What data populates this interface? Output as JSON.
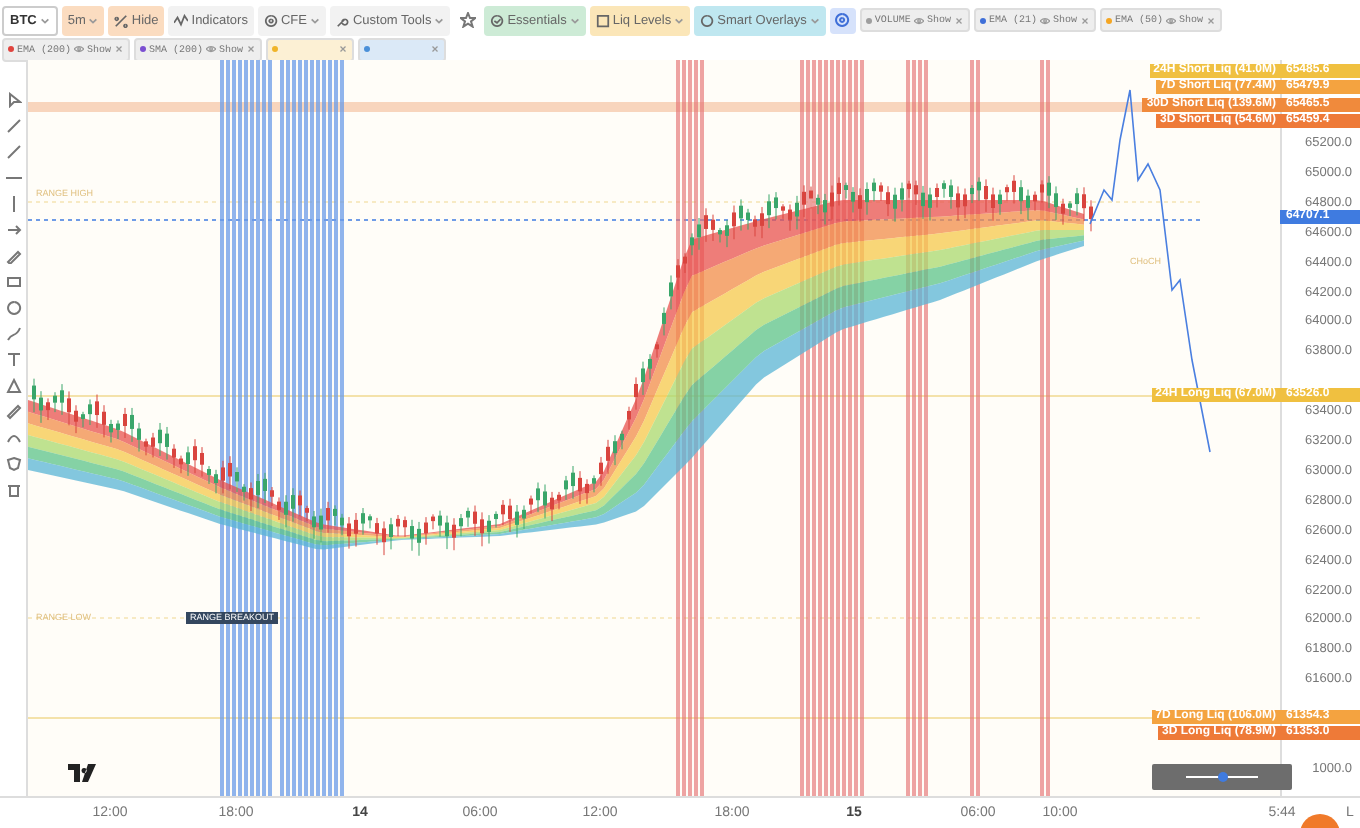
{
  "toolbar": {
    "buttons": [
      {
        "label": "BTC",
        "color": "#ffffff",
        "caret": true,
        "icon": false
      },
      {
        "label": "5m",
        "color": "#fbdcc0",
        "caret": true,
        "icon": false
      },
      {
        "label": "Hide",
        "color": "#fbdcc0",
        "caret": false,
        "icon": true
      },
      {
        "label": "Indicators",
        "color": "#f2f2f2",
        "caret": false,
        "icon": true
      },
      {
        "label": "CFE",
        "color": "#f2f2f2",
        "caret": true,
        "icon": true
      },
      {
        "label": "Custom Tools",
        "color": "#f2f2f2",
        "caret": true,
        "icon": true
      },
      {
        "label": "Essentials",
        "color": "#cdebd6",
        "caret": true,
        "icon": true
      },
      {
        "label": "Liq Levels",
        "color": "#fbe6b8",
        "caret": true,
        "icon": true
      },
      {
        "label": "Smart Overlays",
        "color": "#bfe7f0",
        "caret": true,
        "icon": true
      }
    ],
    "chips": [
      {
        "name": "VOLUME",
        "action": "Show",
        "color": "#9e9e9e"
      },
      {
        "name": "EMA (21)",
        "action": "Show",
        "color": "#3f6fd8"
      },
      {
        "name": "EMA (50)",
        "action": "Show",
        "color": "#f5a623"
      }
    ]
  },
  "indicator_bar": {
    "chips": [
      {
        "name": "EMA (200)",
        "action": "Show",
        "color": "#e0443e"
      },
      {
        "name": "SMA (200)",
        "action": "Show",
        "color": "#7b4fd1"
      },
      {
        "color": "#f0b429"
      },
      {
        "color": "#4a90d9"
      }
    ]
  },
  "chart": {
    "notes": [
      {
        "text": "RANGE HIGH",
        "kind": "faint"
      },
      {
        "text": "RANGE LOW",
        "kind": "faint"
      },
      {
        "text": "RANGE BREAKOUT",
        "kind": "boxed"
      },
      {
        "text": "CHoCH",
        "kind": "faint"
      }
    ],
    "price_axis": [
      "65200.0",
      "65000.0",
      "64800.0",
      "64600.0",
      "64400.0",
      "64200.0",
      "64000.0",
      "63800.0",
      "63400.0",
      "63200.0",
      "63000.0",
      "62800.0",
      "62600.0",
      "62400.0",
      "62200.0",
      "62000.0",
      "61800.0",
      "61600.0",
      "1000.0"
    ],
    "price_tags": [
      {
        "label": "24H Short Liq (41.0M)",
        "price": "65485.6",
        "color": "#f0c040"
      },
      {
        "label": "7D Short Liq (77.4M)",
        "price": "65479.9",
        "color": "#f4a340"
      },
      {
        "label": "30D Short Liq (139.6M)",
        "price": "65465.5",
        "color": "#f08a3c"
      },
      {
        "label": "3D Short Liq (54.6M)",
        "price": "65459.4",
        "color": "#ee7a38"
      },
      {
        "price": "64707.1",
        "color": "#3f7be0"
      },
      {
        "label": "24H Long Liq (67.0M)",
        "price": "63526.0",
        "color": "#f0c040"
      },
      {
        "label": "7D Long Liq (106.0M)",
        "price": "61354.3",
        "color": "#f4a340"
      },
      {
        "label": "3D Long Liq (78.9M)",
        "price": "61353.0",
        "color": "#ee7a38"
      }
    ],
    "time_axis": [
      {
        "text": "12:00",
        "kind": "time"
      },
      {
        "text": "18:00",
        "kind": "time"
      },
      {
        "text": "14",
        "kind": "day"
      },
      {
        "text": "06:00",
        "kind": "time"
      },
      {
        "text": "12:00",
        "kind": "time"
      },
      {
        "text": "18:00",
        "kind": "time"
      },
      {
        "text": "15",
        "kind": "day"
      },
      {
        "text": "06:00",
        "kind": "time"
      },
      {
        "text": "10:00",
        "kind": "time"
      }
    ],
    "status": [
      "5:44",
      "L"
    ]
  },
  "scale_slider": {
    "level": 0.5
  }
}
